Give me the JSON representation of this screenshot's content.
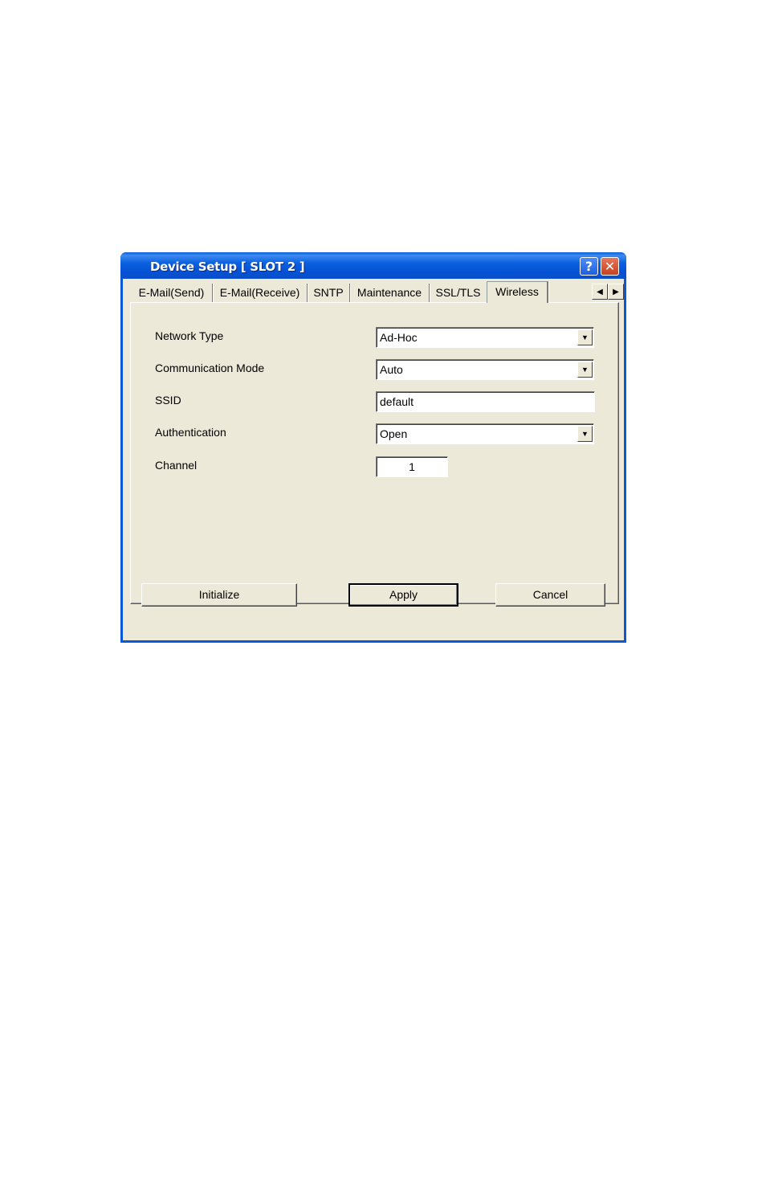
{
  "window": {
    "title": "Device Setup [ SLOT 2 ]",
    "help_glyph": "?",
    "close_glyph": "✕"
  },
  "tabs": [
    {
      "label": "E-Mail(Send)",
      "active": false
    },
    {
      "label": "E-Mail(Receive)",
      "active": false
    },
    {
      "label": "SNTP",
      "active": false
    },
    {
      "label": "Maintenance",
      "active": false
    },
    {
      "label": "SSL/TLS",
      "active": false
    },
    {
      "label": "Wireless",
      "active": true
    }
  ],
  "tab_scroll": {
    "left": "◀",
    "right": "▶"
  },
  "form": {
    "network_type": {
      "label": "Network Type",
      "value": "Ad-Hoc"
    },
    "communication_mode": {
      "label": "Communication Mode",
      "value": "Auto"
    },
    "ssid": {
      "label": "SSID",
      "value": "default"
    },
    "authentication": {
      "label": "Authentication",
      "value": "Open"
    },
    "channel": {
      "label": "Channel",
      "value": "1"
    }
  },
  "buttons": {
    "initialize": "Initialize",
    "apply": "Apply",
    "cancel": "Cancel"
  },
  "colors": {
    "titlebar": "#0a57d8",
    "dialog_face": "#ece9d8"
  }
}
